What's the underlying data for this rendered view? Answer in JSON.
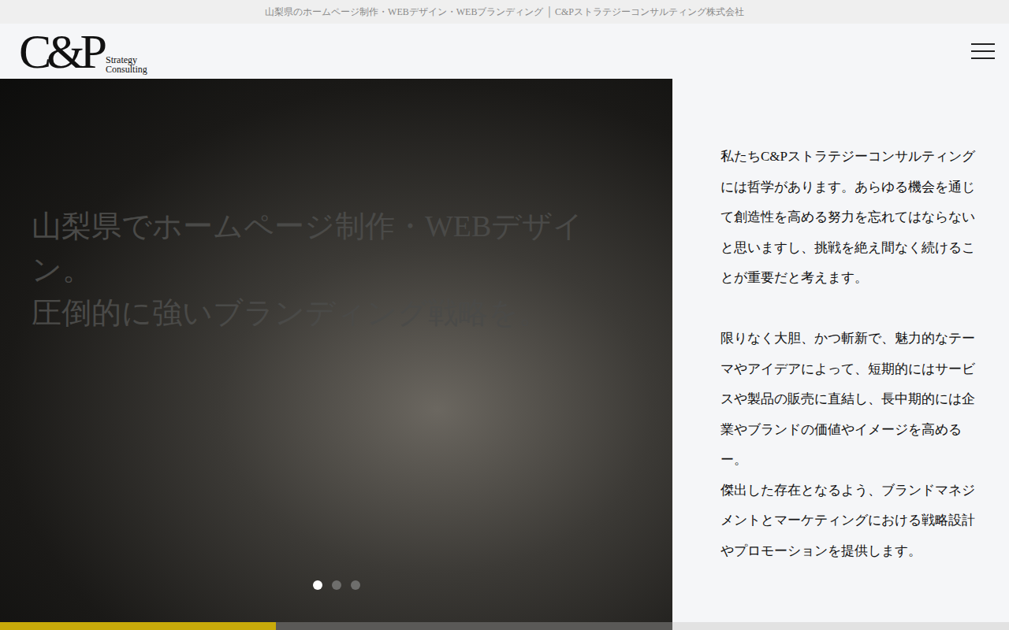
{
  "topbar": {
    "text": "山梨県のホームページ制作・WEBデザイン・WEBブランディング │ C&Pストラテジーコンサルティング株式会社"
  },
  "logo": {
    "main": "C&P",
    "sub1": "Strategy",
    "sub2": "Consulting"
  },
  "hero": {
    "lines": [
      "山梨県でホームページ制作・WEBデザイ",
      "ン。",
      "圧倒的に強いブランディング戦略を。"
    ],
    "dots": [
      {
        "selected": true
      },
      {
        "selected": false
      },
      {
        "selected": false
      }
    ],
    "progress": {
      "level": 0.41
    }
  },
  "copy": {
    "paragraphs": [
      [
        "私たちC&Pストラテジーコンサルティング",
        "には哲学があります。あらゆる機会を通じ",
        "て創造性を高める努力を忘れてはならない",
        "と思いますし、挑戦を絶え間なく続けるこ",
        "とが重要だと考えます。"
      ],
      [
        "限りなく大胆、かつ斬新で、魅力的なテー",
        "マやアイデアによって、短期的にはサービ",
        "スや製品の販売に直結し、長中期的には企",
        "業やブランドの価値やイメージを高める",
        "ー。",
        "傑出した存在となるよう、ブランドマネジ",
        "メントとマーケティングにおける戦略設計",
        "やプロモーションを提供します。"
      ]
    ]
  }
}
